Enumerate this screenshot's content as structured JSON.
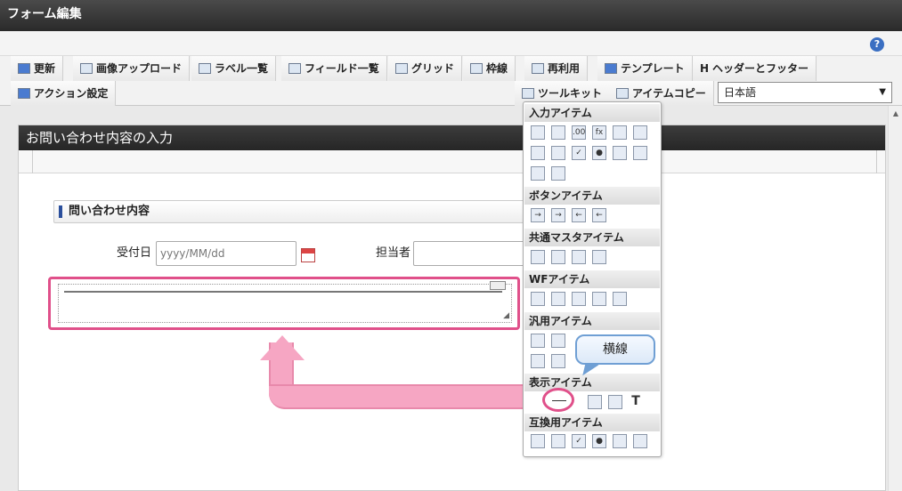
{
  "window": {
    "title": "フォーム編集",
    "help_icon": "?"
  },
  "toolbar": {
    "row1": [
      "更新",
      "画像アップロード",
      "ラベル一覧",
      "フィールド一覧",
      "グリッド",
      "枠線",
      "再利用",
      "テンプレート",
      "ヘッダーとフッター"
    ],
    "row2": {
      "action": "アクション設定",
      "toolkit": "ツールキット",
      "itemcopy": "アイテムコピー",
      "language": "日本語",
      "header_prefix": "H"
    }
  },
  "form": {
    "title": "お問い合わせ内容の入力",
    "section": "問い合わせ内容",
    "date_label": "受付日",
    "date_placeholder": "yyyy/MM/dd",
    "person_label": "担当者"
  },
  "toolkit": {
    "sections": [
      "入力アイテム",
      "ボタンアイテム",
      "共通マスタアイテム",
      "WFアイテム",
      "汎用アイテム",
      "表示アイテム",
      "互換用アイテム"
    ],
    "formula_icon": "fx",
    "decimal_icon": ".00"
  },
  "tooltip": "横線",
  "text_icon": "T"
}
